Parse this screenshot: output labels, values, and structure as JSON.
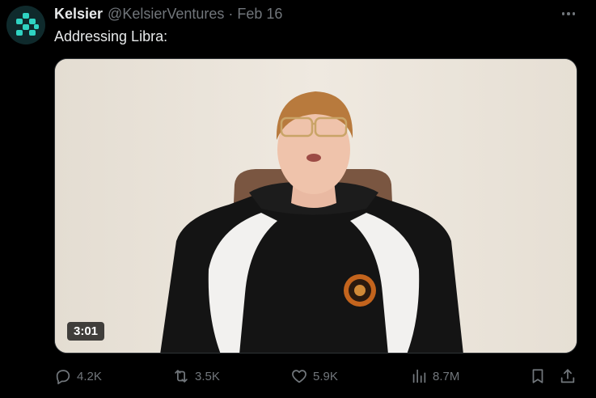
{
  "tweet": {
    "author_name": "Kelsier",
    "handle": "@KelsierVentures",
    "separator": "·",
    "date": "Feb 16",
    "text": "Addressing Libra:"
  },
  "media": {
    "type": "video",
    "duration": "3:01"
  },
  "actions": {
    "replies": "4.2K",
    "reposts": "3.5K",
    "likes": "5.9K",
    "views": "8.7M"
  },
  "icons": {
    "avatar": "kelsier-logo-icon",
    "more": "more-dots-icon",
    "reply": "reply-icon",
    "repost": "repost-icon",
    "like": "heart-icon",
    "views": "views-bar-chart-icon",
    "bookmark": "bookmark-icon",
    "share": "share-icon"
  },
  "colors": {
    "background": "#000000",
    "primary_text": "#e7e9ea",
    "secondary_text": "#71767b",
    "logo_teal": "#2fd3c2"
  }
}
